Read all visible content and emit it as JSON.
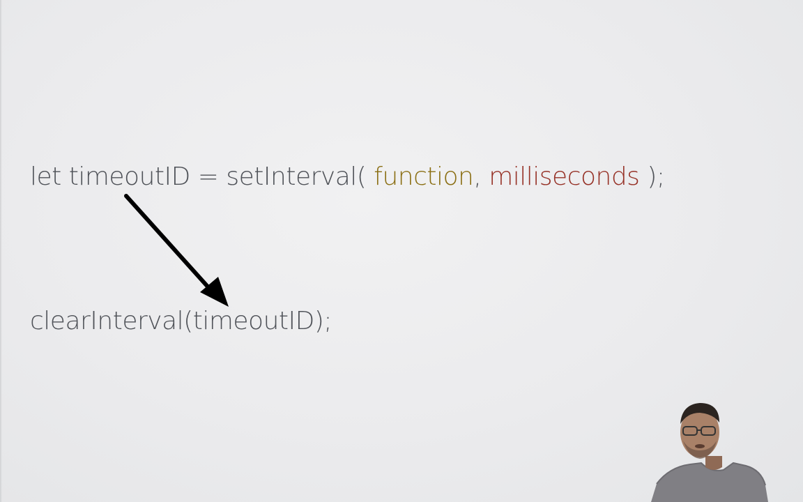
{
  "slide": {
    "line1": {
      "prefix": "let timeoutID = setInterval( ",
      "arg1": "function",
      "comma": ", ",
      "arg2": "milliseconds",
      "suffix": " );"
    },
    "line2": {
      "text": "clearInterval(timeoutID);"
    }
  },
  "colors": {
    "code_default": "#4f5258",
    "function_arg": "#8b6f14",
    "milliseconds_arg": "#963126",
    "arrow": "#000000"
  },
  "icons": {
    "arrow": "arrow-icon",
    "presenter": "presenter-video"
  }
}
